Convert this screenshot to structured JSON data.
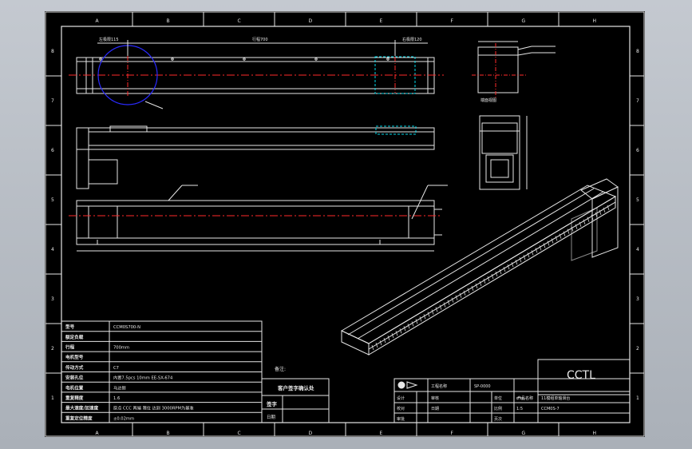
{
  "border": {
    "columns": [
      "A",
      "B",
      "C",
      "D",
      "E",
      "F",
      "G",
      "H"
    ],
    "rows": [
      "8",
      "7",
      "6",
      "5",
      "4",
      "3",
      "2",
      "1"
    ]
  },
  "views": {
    "top": {
      "left_label": "左极限115",
      "stroke_label": "行程700",
      "right_label": "右极限120"
    },
    "end_view": {
      "label": "端面视图"
    },
    "iso": {}
  },
  "colors": {
    "sheet": "#000000",
    "line": "#e6e6e6",
    "centerline": "#ff2a2a",
    "circle": "#2a2aff",
    "hidden": "#00d8e8"
  },
  "spec_table": {
    "rows": [
      {
        "label": "型号",
        "value": "CCM0S700-N"
      },
      {
        "label": "额定负载",
        "value": ""
      },
      {
        "label": "行程",
        "value": "700mm"
      },
      {
        "label": "电机型号",
        "value": ""
      },
      {
        "label": "传动方式",
        "value": "C7"
      },
      {
        "label": "安装孔位",
        "value": "内置7.5pcs 10mm EE-SX-674"
      },
      {
        "label": "电机位置",
        "value": "马达侧"
      },
      {
        "label": "重复精度",
        "value": "1.6"
      },
      {
        "label": "最大速度/加速度",
        "value": "原点 CCC 两端 限位 达到 3000RPM为基准"
      },
      {
        "label": "重复定位精度",
        "value": "±0.02mm"
      }
    ]
  },
  "approval": {
    "note_label": "备注:",
    "customer_label": "客户签字确认处",
    "sign_label": "签字",
    "date_label": "日期"
  },
  "title_block": {
    "company": "CCTL",
    "project_label": "工程名称",
    "project_value": "SP-0000",
    "product_label": "产品名称",
    "product_value": "11模组单轴滑台",
    "drawing_no": "CCM0S-7",
    "rows": [
      {
        "a": "设计",
        "b": "",
        "c": "审核",
        "d": "",
        "e": "单位",
        "f": "mm"
      },
      {
        "a": "校对",
        "b": "",
        "c": "日期",
        "d": "",
        "e": "比例",
        "f": "1:5"
      },
      {
        "a": "审批",
        "b": "",
        "c": "",
        "d": "",
        "e": "页次",
        "f": ""
      }
    ]
  }
}
